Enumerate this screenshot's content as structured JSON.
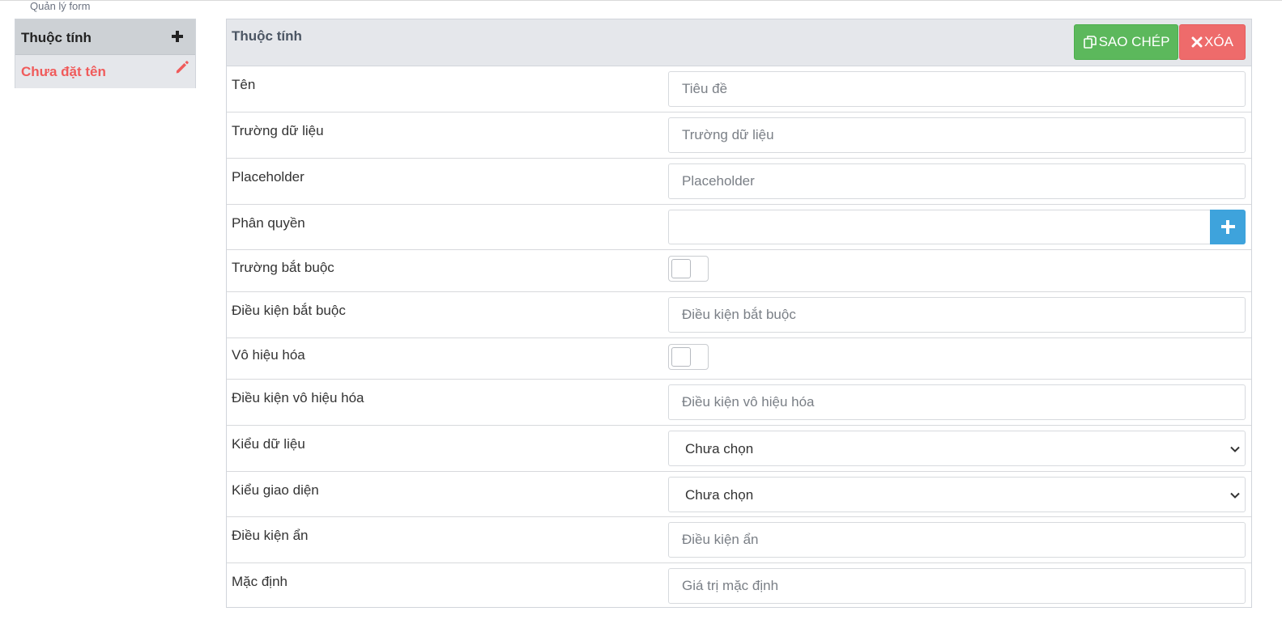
{
  "breadcrumb": "Quản lý form",
  "sidebar": {
    "title": "Thuộc tính",
    "items": [
      {
        "label": "Chưa đặt tên"
      }
    ]
  },
  "panel": {
    "title": "Thuộc tính",
    "copy_label": "SAO CHÉP",
    "delete_label": "XÓA",
    "fields": {
      "ten": {
        "label": "Tên",
        "placeholder": "Tiêu đề",
        "value": ""
      },
      "truong_du_lieu": {
        "label": "Trường dữ liệu",
        "placeholder": "Trường dữ liệu",
        "value": ""
      },
      "placeholder": {
        "label": "Placeholder",
        "placeholder": "Placeholder",
        "value": ""
      },
      "phan_quyen": {
        "label": "Phân quyền",
        "value": ""
      },
      "truong_bat_buoc": {
        "label": "Trường bắt buộc",
        "checked": false
      },
      "dieu_kien_bat_buoc": {
        "label": "Điều kiện bắt buộc",
        "placeholder": "Điều kiện bắt buộc",
        "value": ""
      },
      "vo_hieu_hoa": {
        "label": "Vô hiệu hóa",
        "checked": false
      },
      "dieu_kien_vo_hieu_hoa": {
        "label": "Điều kiện vô hiệu hóa",
        "placeholder": "Điều kiện vô hiệu hóa",
        "value": ""
      },
      "kieu_du_lieu": {
        "label": "Kiểu dữ liệu",
        "selected": "Chưa chọn"
      },
      "kieu_giao_dien": {
        "label": "Kiểu giao diện",
        "selected": "Chưa chọn"
      },
      "dieu_kien_an": {
        "label": "Điều kiện ẩn",
        "placeholder": "Điều kiện ẩn",
        "value": ""
      },
      "mac_dinh": {
        "label": "Mặc định",
        "placeholder": "Giá trị mặc định",
        "value": ""
      }
    }
  },
  "colors": {
    "accent_red": "#f05b5b",
    "copy_green": "#5cb85c",
    "delete_red": "#ee6b6b",
    "add_blue": "#3ea3dc"
  },
  "icons": {
    "sidebar_add": "plus-icon",
    "item_edit": "pencil-icon",
    "copy": "copy-icon",
    "delete": "close-icon",
    "permission_add": "plus-icon",
    "select": "chevron-down-icon"
  }
}
